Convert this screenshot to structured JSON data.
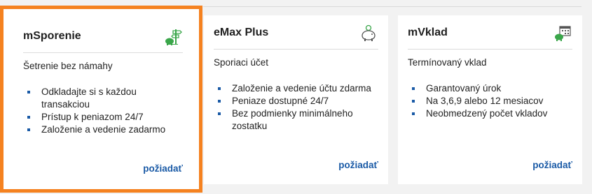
{
  "colors": {
    "accent": "#f58220",
    "link": "#1a5aa6",
    "icon": "#3aa64a"
  },
  "cards": [
    {
      "title": "mSporenie",
      "icon": "piggy-bank-signpost-icon",
      "subtitle": "Šetrenie bez námahy",
      "features": [
        "Odkladajte si s každou transakciou",
        "Prístup k peniazom 24/7",
        "Založenie a vedenie zadarmo"
      ],
      "cta": "požiadať",
      "selected": true
    },
    {
      "title": "eMax Plus",
      "icon": "piggy-bank-coin-icon",
      "subtitle": "Sporiaci účet",
      "features": [
        "Založenie a vedenie účtu zdarma",
        "Peniaze dostupné 24/7",
        "Bez podmienky minimálneho zostatku"
      ],
      "cta": "požiadať",
      "selected": false
    },
    {
      "title": "mVklad",
      "icon": "calendar-piggy-bank-icon",
      "subtitle": "Termínovaný vklad",
      "features": [
        "Garantovaný úrok",
        "Na 3,6,9 alebo 12 mesiacov",
        "Neobmedzený počet vkladov"
      ],
      "cta": "požiadať",
      "selected": false
    }
  ]
}
